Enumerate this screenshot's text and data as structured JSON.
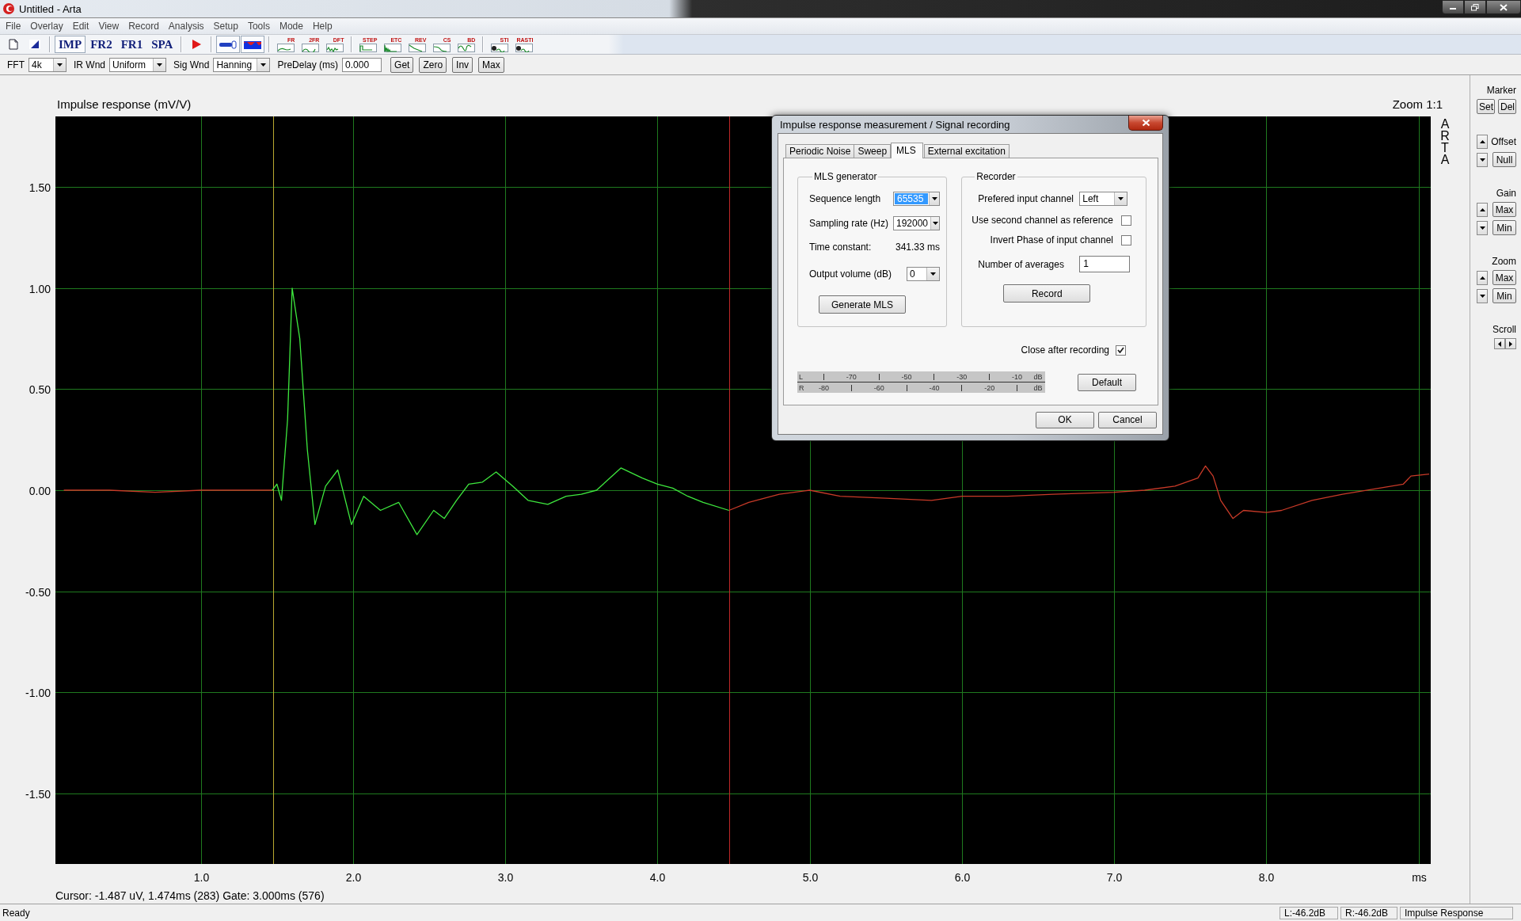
{
  "window": {
    "title": "Untitled - Arta"
  },
  "menu": [
    "File",
    "Overlay",
    "Edit",
    "View",
    "Record",
    "Analysis",
    "Setup",
    "Tools",
    "Mode",
    "Help"
  ],
  "toolbar": {
    "modes": [
      {
        "label": "IMP",
        "selected": true
      },
      {
        "label": "FR2",
        "selected": false
      },
      {
        "label": "FR1",
        "selected": false
      },
      {
        "label": "SPA",
        "selected": false
      }
    ],
    "toggles": [
      {
        "selected": true
      },
      {
        "selected": true
      }
    ],
    "graphs": [
      "FR",
      "2FR",
      "DFT",
      "STEP",
      "ETC",
      "REV",
      "CS",
      "BD",
      "STI",
      "RASTI"
    ]
  },
  "params": [
    {
      "kind": "select",
      "label": "FFT",
      "value": "4k"
    },
    {
      "kind": "select",
      "label": "IR Wnd",
      "value": "Uniform"
    },
    {
      "kind": "select",
      "label": "Sig Wnd",
      "value": "Hanning"
    },
    {
      "kind": "input",
      "label": "PreDelay (ms)",
      "value": "0.000"
    }
  ],
  "param_buttons": [
    "Get",
    "Zero",
    "Inv",
    "Max"
  ],
  "plot": {
    "title": "Impulse response (mV/V)",
    "zoom": "Zoom 1:1",
    "logo": "ARTA",
    "cursor_info": "Cursor: -1.487 uV, 1.474ms (283)  Gate: 3.000ms (576)",
    "chart_data": {
      "type": "line",
      "xlabel": "ms",
      "xlim": [
        0.045,
        9.08
      ],
      "ylim": [
        -1.85,
        1.85
      ],
      "xticks": [
        {
          "value": 1,
          "label": "1.0"
        },
        {
          "value": 2,
          "label": "2.0"
        },
        {
          "value": 3,
          "label": "3.0"
        },
        {
          "value": 4,
          "label": "4.0"
        },
        {
          "value": 5,
          "label": "5.0"
        },
        {
          "value": 6,
          "label": "6.0"
        },
        {
          "value": 7,
          "label": "7.0"
        },
        {
          "value": 8,
          "label": "8.0"
        }
      ],
      "yticks": [
        {
          "value": 1.5,
          "label": "1.50"
        },
        {
          "value": 1,
          "label": "1.00"
        },
        {
          "value": 0.5,
          "label": "0.50"
        },
        {
          "value": 0,
          "label": "0.00"
        },
        {
          "value": -0.5,
          "label": "-0.50"
        },
        {
          "value": -1,
          "label": "-1.00"
        },
        {
          "value": -1.5,
          "label": "-1.50"
        }
      ],
      "x": [
        0.1,
        0.4,
        0.7,
        1.0,
        1.2,
        1.35,
        1.47,
        1.5,
        1.53,
        1.57,
        1.6,
        1.65,
        1.7,
        1.75,
        1.82,
        1.9,
        1.99,
        2.07,
        2.18,
        2.3,
        2.42,
        2.53,
        2.6,
        2.68,
        2.76,
        2.85,
        2.94,
        3.05,
        3.15,
        3.28,
        3.4,
        3.5,
        3.6,
        3.76,
        3.9,
        4.0,
        4.1,
        4.2,
        4.3,
        4.47,
        4.6,
        4.8,
        5.0,
        5.2,
        5.5,
        5.8,
        6.0,
        6.3,
        6.6,
        7.0,
        7.2,
        7.4,
        7.55,
        7.6,
        7.65,
        7.7,
        7.78,
        7.85,
        8.0,
        8.1,
        8.3,
        8.5,
        8.9,
        8.95,
        9.07
      ],
      "series": [
        {
          "color": "#c83a28",
          "values": [
            0,
            0,
            -0.01,
            0,
            0,
            0,
            0,
            null,
            null,
            null,
            null,
            null,
            null,
            null,
            null,
            null,
            null,
            null,
            null,
            null,
            null,
            null,
            null,
            null,
            null,
            null,
            null,
            null,
            null,
            null,
            null,
            null,
            null,
            null,
            null,
            null,
            null,
            null,
            null,
            -0.1,
            -0.06,
            -0.02,
            0,
            -0.03,
            -0.04,
            -0.05,
            -0.03,
            -0.03,
            -0.02,
            -0.01,
            0,
            0.02,
            0.06,
            0.12,
            0.07,
            -0.05,
            -0.14,
            -0.1,
            -0.11,
            -0.1,
            -0.05,
            -0.02,
            0.03,
            0.07,
            0.08
          ]
        },
        {
          "color": "#3ee83e",
          "values": [
            null,
            null,
            null,
            null,
            null,
            null,
            0,
            0.03,
            -0.05,
            0.35,
            1.0,
            0.75,
            0.2,
            -0.17,
            0.02,
            0.1,
            -0.17,
            -0.03,
            -0.1,
            -0.06,
            -0.22,
            -0.1,
            -0.14,
            -0.05,
            0.03,
            0.04,
            0.09,
            0.02,
            -0.05,
            -0.07,
            -0.03,
            -0.02,
            0.0,
            0.11,
            0.06,
            0.03,
            0.01,
            -0.03,
            -0.06,
            -0.1,
            null,
            null,
            null,
            null,
            null,
            null,
            null,
            null,
            null,
            null,
            null,
            null,
            null,
            null,
            null,
            null,
            null,
            null,
            null,
            null,
            null,
            null,
            null,
            null,
            null
          ]
        }
      ],
      "grid": true,
      "ref_lines": [
        {
          "axis": "x",
          "value": 1.474,
          "color": "#b8a830"
        },
        {
          "axis": "x",
          "value": 4.474,
          "color": "#c02828"
        }
      ]
    }
  },
  "side": {
    "marker": {
      "label": "Marker",
      "buttons": [
        "Set",
        "Del"
      ]
    },
    "groups": [
      {
        "kind": "inline",
        "label": "Offset",
        "buttons": [
          "Null"
        ]
      },
      {
        "kind": "stacked",
        "label": "Gain",
        "buttons": [
          "Max",
          "Min"
        ]
      },
      {
        "kind": "stacked",
        "label": "Zoom",
        "buttons": [
          "Max",
          "Min"
        ]
      }
    ],
    "scroll": {
      "label": "Scroll"
    }
  },
  "dialog": {
    "title": "Impulse response measurement / Signal recording",
    "tabs": [
      {
        "label": "Periodic Noise",
        "selected": false
      },
      {
        "label": "Sweep",
        "selected": false
      },
      {
        "label": "MLS",
        "selected": true
      },
      {
        "label": "External excitation",
        "selected": false
      }
    ],
    "generator": {
      "title": "MLS generator",
      "sequence_length": {
        "label": "Sequence length",
        "value": "65535",
        "highlighted": true
      },
      "sampling_rate": {
        "label": "Sampling rate (Hz)",
        "value": "192000",
        "highlighted": false
      },
      "time_constant": {
        "label": "Time constant:",
        "value": "341.33 ms"
      },
      "output_volume": {
        "label": "Output volume (dB)",
        "value": "0",
        "highlighted": false
      },
      "button": "Generate MLS"
    },
    "recorder": {
      "title": "Recorder",
      "input_channel": {
        "label": "Prefered input channel",
        "value": "Left",
        "highlighted": false
      },
      "options": [
        {
          "label": "Use second channel as reference",
          "checked": false
        },
        {
          "label": "Invert Phase of input channel",
          "checked": false
        }
      ],
      "averages": {
        "label": "Number of averages",
        "value": "1"
      },
      "button": "Record"
    },
    "close_after": {
      "label": "Close after recording",
      "checked": true
    },
    "meter": [
      {
        "channel": "L",
        "ticks": [
          "-70",
          "-50",
          "-30",
          "-10"
        ],
        "unit": "dB"
      },
      {
        "channel": "R",
        "ticks": [
          "-80",
          "-60",
          "-40",
          "-20"
        ],
        "unit": "dB"
      }
    ],
    "default_button": "Default",
    "buttons": [
      "OK",
      "Cancel"
    ]
  },
  "status": {
    "text": "Ready",
    "panes": [
      "L:-46.2dB",
      "R:-46.2dB",
      "Impulse Response"
    ]
  }
}
